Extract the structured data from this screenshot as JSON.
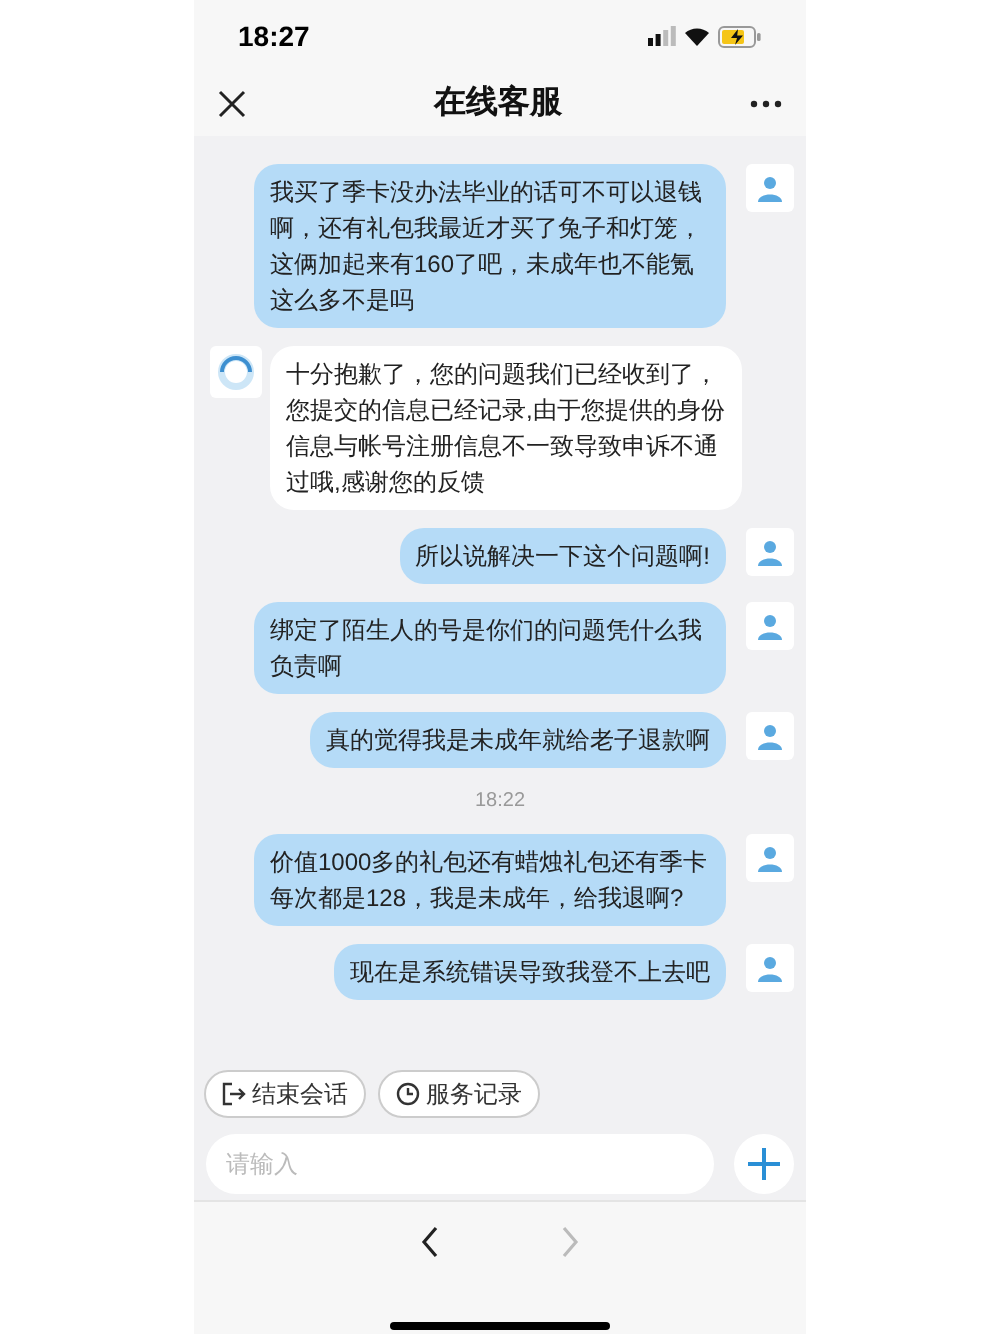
{
  "status_bar": {
    "time": "18:27"
  },
  "header": {
    "title": "在线客服"
  },
  "messages": [
    {
      "kind": "user",
      "text": "我买了季卡没办法毕业的话可不可以退钱啊，还有礼包我最近才买了兔子和灯笼，这俩加起来有160了吧，未成年也不能氪这么多不是吗"
    },
    {
      "kind": "agent",
      "text": "十分抱歉了，您的问题我们已经收到了，您提交的信息已经记录,由于您提供的身份信息与帐号注册信息不一致导致申诉不通过哦,感谢您的反馈"
    },
    {
      "kind": "user",
      "text": "所以说解决一下这个问题啊!"
    },
    {
      "kind": "user",
      "text": "绑定了陌生人的号是你们的问题凭什么我负责啊"
    },
    {
      "kind": "user",
      "text": "真的觉得我是未成年就给老子退款啊"
    },
    {
      "kind": "time",
      "text": "18:22"
    },
    {
      "kind": "user",
      "text": "价值1000多的礼包还有蜡烛礼包还有季卡每次都是128，我是未成年，给我退啊?"
    },
    {
      "kind": "user",
      "text": "现在是系统错误导致我登不上去吧"
    }
  ],
  "quick_actions": [
    {
      "kind": "end",
      "label": "结束会话"
    },
    {
      "kind": "history",
      "label": "服务记录"
    }
  ],
  "input": {
    "placeholder": "请输入"
  },
  "nav": {
    "back_enabled": true,
    "forward_enabled": false
  }
}
